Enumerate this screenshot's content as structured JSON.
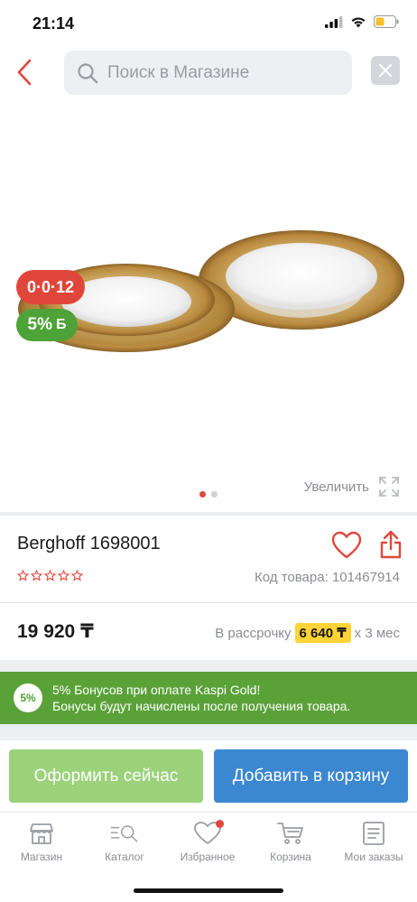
{
  "status_bar": {
    "time": "21:14"
  },
  "header": {
    "search_placeholder": "Поиск в Магазине"
  },
  "gallery": {
    "timer_badge": "0·0·12",
    "bonus_badge": {
      "percent": "5%",
      "sign": "Б"
    },
    "image_count": 2,
    "active_index": 0,
    "zoom_label": "Увеличить"
  },
  "product": {
    "title": "Berghoff 1698001",
    "rating": 0,
    "code": "Код товара: 101467914",
    "price": "19 920 ₸",
    "installment_prefix": "В рассрочку",
    "installment_amount": "6 640 ₸",
    "installment_suffix": "x 3 мес"
  },
  "bonus_banner": {
    "circle": "5%",
    "line1": "5% Бонусов при оплате Kaspi Gold!",
    "line2": "Бонусы будут начислены после получения товара."
  },
  "actions": {
    "buy_now": "Оформить сейчас",
    "add_to_cart": "Добавить в корзину"
  },
  "tabs": [
    {
      "label": "Магазин",
      "icon": "shop-icon"
    },
    {
      "label": "Каталог",
      "icon": "catalog-search-icon"
    },
    {
      "label": "Избранное",
      "icon": "heart-icon",
      "has_badge": true
    },
    {
      "label": "Корзина",
      "icon": "cart-icon"
    },
    {
      "label": "Мои заказы",
      "icon": "orders-icon"
    }
  ],
  "colors": {
    "accent_red": "#e0473a",
    "bonus_green": "#5aa238",
    "buy_now_green": "#9bd27a",
    "cart_blue": "#3b87d0",
    "installment_yellow": "#ffd335"
  }
}
